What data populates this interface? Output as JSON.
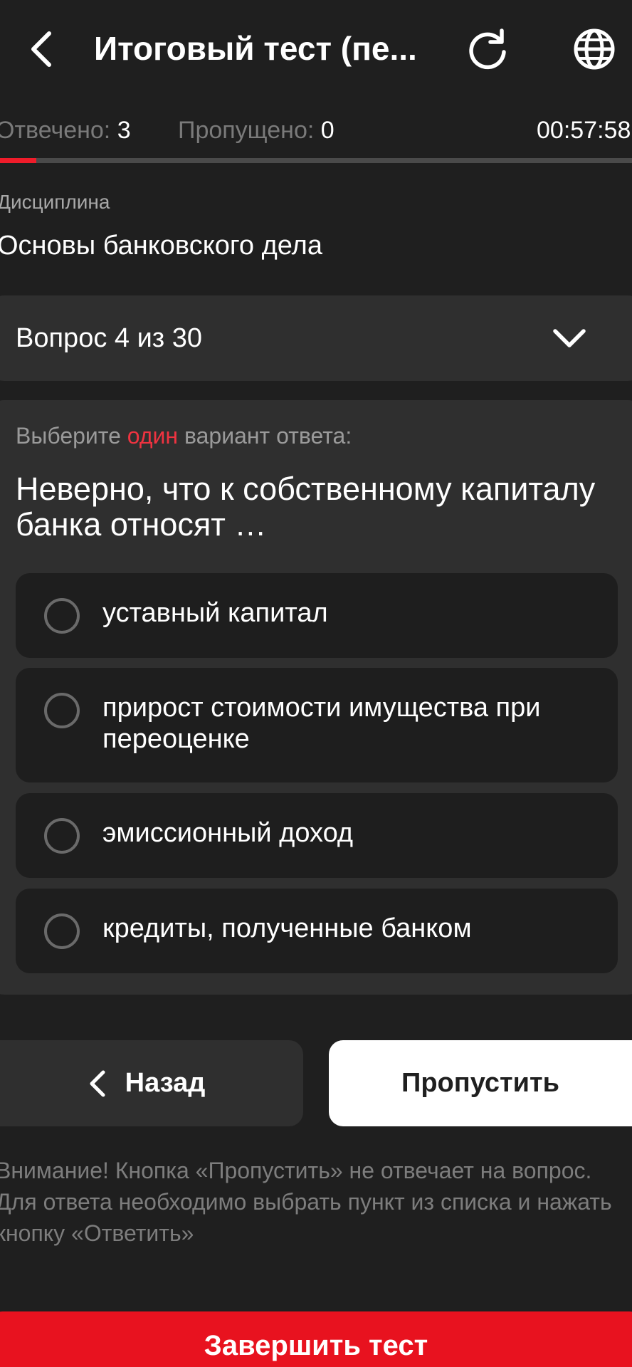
{
  "header": {
    "title": "Итоговый тест (пе...",
    "back_icon": "chevron-left-icon",
    "refresh_icon": "refresh-icon",
    "language_icon": "globe-icon"
  },
  "stats": {
    "answered_label": "Отвечено:",
    "answered_value": "3",
    "skipped_label": "Пропущено:",
    "skipped_value": "0",
    "timer": "00:57:58"
  },
  "progress": {
    "fraction": 0.057,
    "color": "#ef1c2a"
  },
  "discipline": {
    "label": "Дисциплина",
    "value": "Основы банковского дела"
  },
  "question_selector": {
    "label": "Вопрос 4 из 30",
    "icon": "chevron-down-icon"
  },
  "question": {
    "instruction_prefix": "Выберите",
    "instruction_accent": "один",
    "instruction_suffix": "вариант ответа:",
    "text": "Неверно, что к собственному капиталу банка относят …",
    "options": [
      {
        "label": "уставный капитал",
        "selected": false
      },
      {
        "label": "прирост стоимости имущества при переоценке",
        "selected": false
      },
      {
        "label": "эмиссионный доход",
        "selected": false
      },
      {
        "label": "кредиты, полученные банком",
        "selected": false
      }
    ]
  },
  "actions": {
    "back_label": "Назад",
    "skip_label": "Пропустить",
    "finish_label": "Завершить тест"
  },
  "warning": "Внимание! Кнопка «Пропустить» не отвечает на вопрос. Для ответа необходимо выбрать пункт из списка и нажать кнопку «Ответить»",
  "colors": {
    "background": "#1f1f1f",
    "card": "#2f2f2f",
    "accent": "#e8121f"
  }
}
